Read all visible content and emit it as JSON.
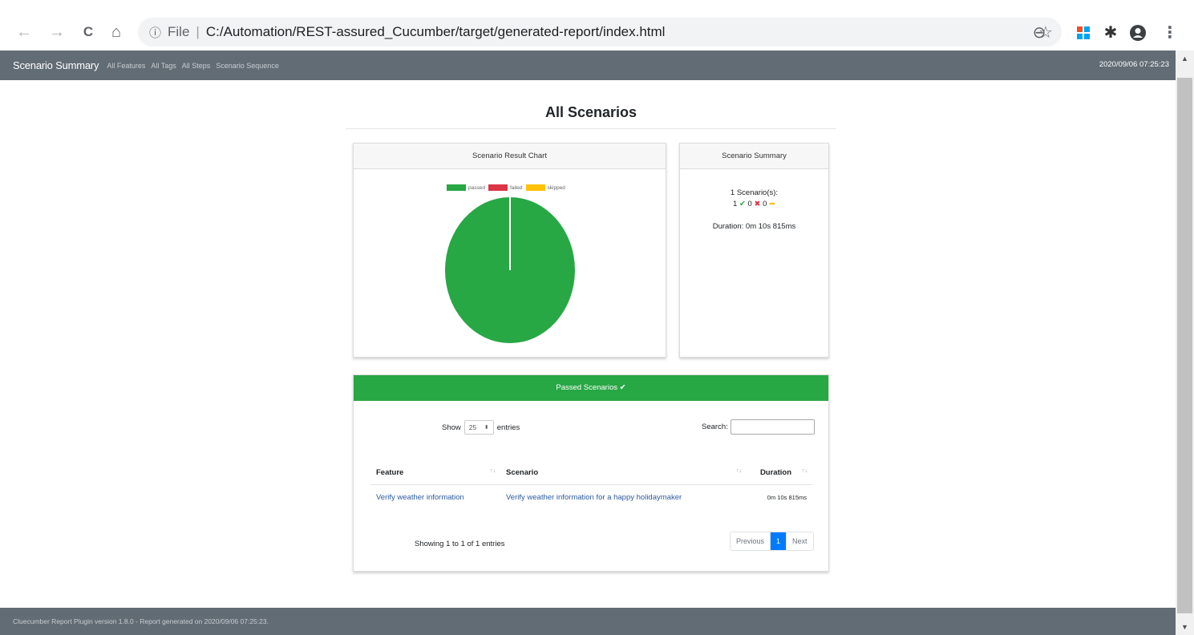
{
  "browser": {
    "back_icon": "←",
    "forward_icon": "→",
    "reload_icon": "C",
    "home_icon": "⌂",
    "info_icon": "ⓘ",
    "scheme": "File",
    "url": "C:/Automation/REST-assured_Cucumber/target/generated-report/index.html",
    "zoom_icon": "⊖",
    "star_icon": "☆",
    "extensions_icon": "✱",
    "profile_icon": "●",
    "menu_icon": "⋮"
  },
  "header": {
    "brand": "Scenario Summary",
    "nav": [
      "All Features",
      "All Tags",
      "All Steps",
      "Scenario Sequence"
    ],
    "date": "2020/09/06 07:25:23"
  },
  "main": {
    "title": "All Scenarios",
    "chart_card": {
      "title": "Scenario Result Chart"
    },
    "summary_card": {
      "title": "Scenario Summary",
      "scenarios_label": "1 Scenario(s):",
      "passed_count": "1",
      "failed_count": "0",
      "skipped_count": "0",
      "passed_icon": "✔",
      "failed_icon": "✖",
      "skipped_icon": "➦",
      "duration": "Duration: 0m 10s 815ms"
    },
    "passed_card": {
      "title": "Passed Scenarios ✔",
      "show_label": "Show",
      "page_size": "25",
      "entries_label": "entries",
      "search_label": "Search:",
      "search_value": "",
      "columns": [
        "Feature",
        "Scenario",
        "Duration"
      ],
      "sort_icon": "↑↓",
      "rows": [
        {
          "feature": "Verify weather information",
          "scenario": "Verify weather information for a happy holidaymaker",
          "duration": "0m 10s 815ms"
        }
      ],
      "info": "Showing 1 to 1 of 1 entries",
      "pager": {
        "previous": "Previous",
        "page": "1",
        "next": "Next"
      }
    }
  },
  "footer": {
    "text": "Cluecumber Report Plugin version 1.8.0 - Report generated on 2020/09/06 07:25:23."
  },
  "colors": {
    "passed": "#28a745",
    "failed": "#dc3545",
    "skipped": "#ffc107",
    "header": "#626c75"
  },
  "chart_data": {
    "type": "pie",
    "categories": [
      "passed",
      "failed",
      "skipped"
    ],
    "values": [
      1,
      0,
      0
    ],
    "colors": [
      "#28a745",
      "#dc3545",
      "#ffc107"
    ],
    "legend": "top"
  }
}
